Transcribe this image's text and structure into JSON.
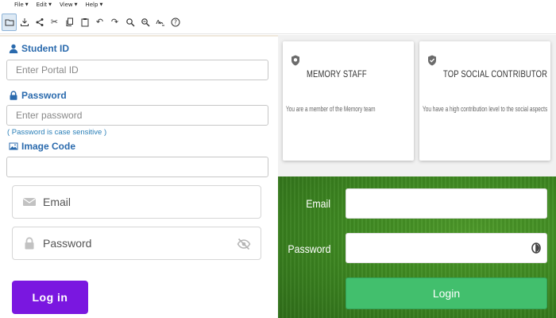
{
  "menubar": {
    "items": [
      {
        "label": "File"
      },
      {
        "label": "Edit"
      },
      {
        "label": "View"
      },
      {
        "label": "Help"
      }
    ]
  },
  "toolbar": {
    "icons": [
      "open-folder-icon",
      "download-icon",
      "share-icon",
      "cut-icon",
      "copy-icon",
      "paste-icon",
      "undo-icon",
      "redo-icon",
      "zoom-in-icon",
      "zoom-out-icon",
      "signature-icon",
      "help-icon"
    ]
  },
  "student_form": {
    "student_id_label": "Student ID",
    "student_id_placeholder": "Enter Portal ID",
    "password_label": "Password",
    "password_placeholder": "Enter password",
    "password_hint": "( Password is case sensitive )",
    "image_code_label": "Image Code",
    "image_code_value": ""
  },
  "cards": [
    {
      "title": "MEMORY STAFF",
      "text": "You are a member of the Memory team",
      "icon": "shield-badge-icon"
    },
    {
      "title": "TOP SOCIAL CONTRIBUTOR",
      "text": "You have a high contribution level to the social aspects",
      "icon": "shield-check-icon"
    }
  ],
  "login_left": {
    "email_placeholder": "Email",
    "password_placeholder": "Password",
    "button_label": "Log in",
    "accent_color": "#7a17e0"
  },
  "login_right": {
    "email_label": "Email",
    "password_label": "Password",
    "email_value": "",
    "password_value": "",
    "button_label": "Login",
    "button_color": "#42bf6d"
  }
}
